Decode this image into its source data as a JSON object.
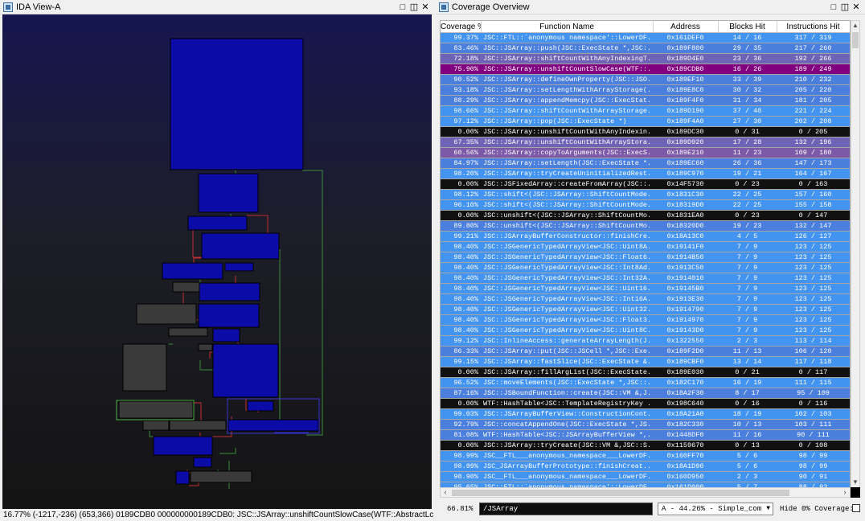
{
  "ida_view": {
    "title": "IDA View-A",
    "status_bar": "16.77%  (-1217,-236)  (653,366)  0189CDB0  000000000189CDB0: JSC::JSArray::unshiftCountSlowCase(WTF::AbstractLc  (Synchronized with Hex View-1)"
  },
  "coverage": {
    "title": "Coverage Overview",
    "columns": [
      "Coverage %",
      "Function Name",
      "Address",
      "Blocks Hit",
      "Instructions Hit"
    ],
    "rows": [
      [
        "99.37%",
        "JSC::FTL::`anonymous namespace'::LowerDF...",
        "0x161DEF0",
        "14 / 16",
        "317 / 319"
      ],
      [
        "83.46%",
        "JSC::JSArray::push(JSC::ExecState *,JSC:...",
        "0x189F800",
        "29 / 35",
        "217 / 260"
      ],
      [
        "72.18%",
        "JSC::JSArray::shiftCountWithAnyIndexingT...",
        "0x189D4E0",
        "23 / 36",
        "192 / 266"
      ],
      [
        "75.90%",
        "JSC::JSArray::unshiftCountSlowCase(WTF::...",
        "0x189CDB0",
        "16 / 26",
        "189 / 249"
      ],
      [
        "90.52%",
        "JSC::JSArray::defineOwnProperty(JSC::JSO...",
        "0x189EF10",
        "33 / 39",
        "210 / 232"
      ],
      [
        "93.18%",
        "JSC::JSArray::setLengthWithArrayStorage(...",
        "0x189E8C0",
        "30 / 32",
        "205 / 220"
      ],
      [
        "88.29%",
        "JSC::JSArray::appendMemcpy(JSC::ExecStat...",
        "0x189F4F0",
        "31 / 34",
        "181 / 205"
      ],
      [
        "98.66%",
        "JSC::JSArray::shiftCountWithArrayStorage...",
        "0x189D190",
        "37 / 40",
        "221 / 224"
      ],
      [
        "97.12%",
        "JSC::JSArray::pop(JSC::ExecState *)",
        "0x189F4A0",
        "27 / 30",
        "202 / 208"
      ],
      [
        "0.00%",
        "JSC::JSArray::unshiftCountWithAnyIndexin...",
        "0x189DC30",
        "0 / 31",
        "0 / 205"
      ],
      [
        "67.35%",
        "JSC::JSArray::unshiftCountWithArrayStora...",
        "0x189D920",
        "17 / 28",
        "132 / 196"
      ],
      [
        "60.56%",
        "JSC::JSArray::copyToArguments(JSC::ExecS...",
        "0x189E210",
        "11 / 23",
        "109 / 180"
      ],
      [
        "84.97%",
        "JSC::JSArray::setLength(JSC::ExecState *...",
        "0x189EC60",
        "26 / 36",
        "147 / 173"
      ],
      [
        "98.20%",
        "JSC::JSArray::tryCreateUninitializedRest...",
        "0x189C970",
        "19 / 21",
        "164 / 167"
      ],
      [
        "0.00%",
        "JSC::JSFixedArray::createFromArray(JSC::...",
        "0x14F5730",
        "0 / 23",
        "0 / 163"
      ],
      [
        "98.12%",
        "JSC::shift<(JSC::JSArray::ShiftCountMode...",
        "0x1831C30",
        "22 / 25",
        "157 / 160"
      ],
      [
        "96.10%",
        "JSC::shift<(JSC::JSArray::ShiftCountMode...",
        "0x18319D0",
        "22 / 25",
        "155 / 158"
      ],
      [
        "0.00%",
        "JSC::unshift<(JSC::JSArray::ShiftCountMo...",
        "0x1831EA0",
        "0 / 23",
        "0 / 147"
      ],
      [
        "89.80%",
        "JSC::unshift<(JSC::JSArray::ShiftCountMo...",
        "0x18320D0",
        "19 / 23",
        "132 / 147"
      ],
      [
        "99.21%",
        "JSC::JSArrayBufferConstructor::finishCre...",
        "0x18A13C0",
        "4 / 5",
        "126 / 127"
      ],
      [
        "98.40%",
        "JSC::JSGenericTypedArrayView<JSC::Uint8A...",
        "0x19141F0",
        "7 / 9",
        "123 / 125"
      ],
      [
        "98.40%",
        "JSC::JSGenericTypedArrayView<JSC::Float6...",
        "0x1914B50",
        "7 / 9",
        "123 / 125"
      ],
      [
        "98.40%",
        "JSC::JSGenericTypedArrayView<JSC::Int8Ad...",
        "0x1913C50",
        "7 / 9",
        "123 / 125"
      ],
      [
        "98.40%",
        "JSC::JSGenericTypedArrayView<JSC::Int32A...",
        "0x1914010",
        "7 / 9",
        "123 / 125"
      ],
      [
        "98.40%",
        "JSC::JSGenericTypedArrayView<JSC::Uint16...",
        "0x19145B0",
        "7 / 9",
        "123 / 125"
      ],
      [
        "98.40%",
        "JSC::JSGenericTypedArrayView<JSC::Int16A...",
        "0x1913E30",
        "7 / 9",
        "123 / 125"
      ],
      [
        "98.40%",
        "JSC::JSGenericTypedArrayView<JSC::Uint32...",
        "0x1914790",
        "7 / 9",
        "123 / 125"
      ],
      [
        "98.40%",
        "JSC::JSGenericTypedArrayView<JSC::Float3...",
        "0x1914970",
        "7 / 9",
        "123 / 125"
      ],
      [
        "98.40%",
        "JSC::JSGenericTypedArrayView<JSC::Uint8C...",
        "0x19143D0",
        "7 / 9",
        "123 / 125"
      ],
      [
        "99.12%",
        "JSC::InlineAccess::generateArrayLength(J...",
        "0x1322550",
        "2 / 3",
        "113 / 114"
      ],
      [
        "86.33%",
        "JSC::JSArray::put(JSC::JSCell *,JSC::Exe...",
        "0x189F2D0",
        "11 / 13",
        "106 / 120"
      ],
      [
        "99.15%",
        "JSC::JSArray::fastSlice(JSC::ExecState &...",
        "0x189CBF0",
        "13 / 14",
        "117 / 118"
      ],
      [
        "0.00%",
        "JSC::JSArray::fillArgList(JSC::ExecState...",
        "0x189E030",
        "0 / 21",
        "0 / 117"
      ],
      [
        "96.52%",
        "JSC::moveElements(JSC::ExecState *,JSC::...",
        "0x182C170",
        "16 / 19",
        "111 / 115"
      ],
      [
        "87.16%",
        "JSC::JSBoundFunction::create(JSC::VM &,J...",
        "0x18A2F30",
        "8 / 17",
        "95 / 109"
      ],
      [
        "0.00%",
        "WTF::HashTable<JSC::TemplateRegistryKey ...",
        "0x198C640",
        "0 / 16",
        "0 / 116"
      ],
      [
        "99.03%",
        "JSC::JSArrayBufferView::ConstructionCont...",
        "0x18A21A0",
        "18 / 19",
        "102 / 103"
      ],
      [
        "92.79%",
        "JSC::concatAppendOne(JSC::ExecState *,JS...",
        "0x182C330",
        "10 / 13",
        "103 / 111"
      ],
      [
        "81.08%",
        "WTF::HashTable<JSC::JSArrayBufferView *,...",
        "0x1448DF0",
        "11 / 16",
        "90 / 111"
      ],
      [
        "0.00%",
        "JSC::JSArray::tryCreate(JSC::VM &,JSC::S...",
        "0x1159670",
        "0 / 13",
        "0 / 108"
      ],
      [
        "98.99%",
        "JSC__FTL___anonymous_namespace___LowerDF...",
        "0x160FF70",
        "5 / 6",
        "98 / 99"
      ],
      [
        "98.99%",
        "JSC_JSArrayBufferPrototype::finishCreat...",
        "0x18A1D90",
        "5 / 6",
        "98 / 99"
      ],
      [
        "98.90%",
        "JSC__FTL___anonymous_namespace___LowerDF...",
        "0x160D950",
        "2 / 3",
        "90 / 91"
      ],
      [
        "95.65%",
        "JSC::FTL::`anonymous namespace'::LowerDF...",
        "0x161D000",
        "5 / 7",
        "88 / 92"
      ]
    ],
    "selected_index": 3,
    "footer": {
      "total_coverage": "66.81%",
      "filter_value": "/JSArray",
      "composition": "A - 44.26% - Simple_com",
      "hide_zero_label": "Hide 0% Coverage:"
    },
    "row_colors": {
      "full": "#4393f0",
      "high": "#4a7fde",
      "mid": "#6f63b6",
      "low": "#7d5aa7",
      "zero": "#111111",
      "selected": "#80007f"
    }
  }
}
